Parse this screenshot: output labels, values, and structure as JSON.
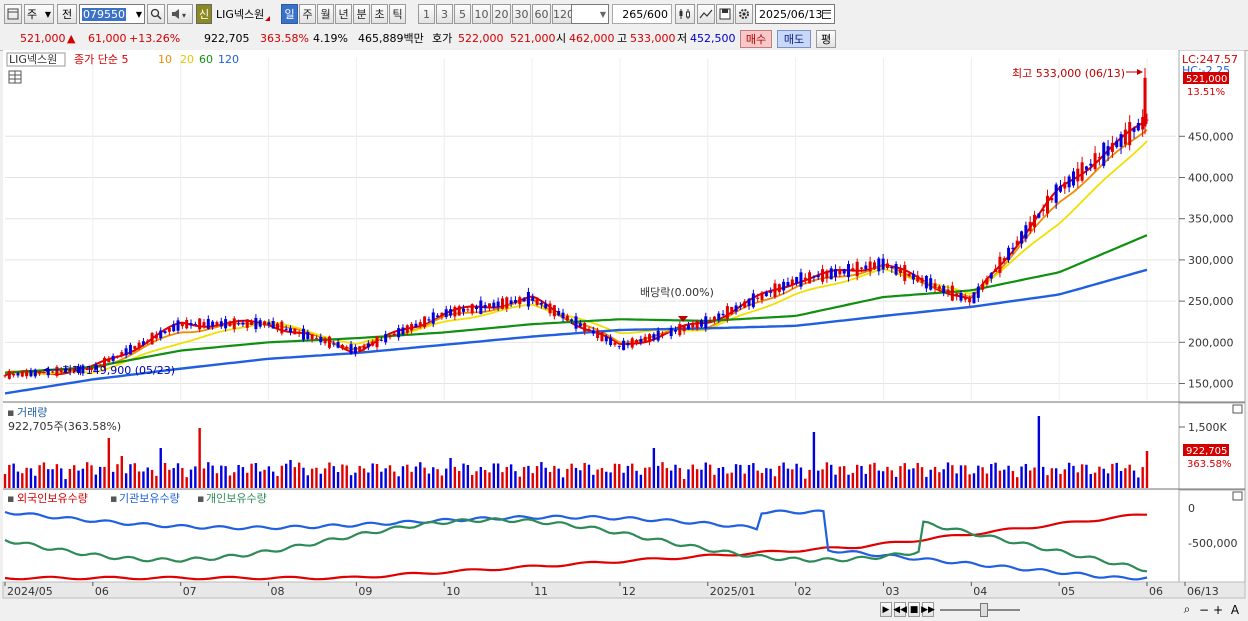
{
  "toolbar": {
    "mode_label": "주",
    "prev_label": "전",
    "code_value": "079550",
    "market_badge": "신",
    "stock_name": "LIG넥스원",
    "period_tabs": [
      "일",
      "주",
      "월",
      "년",
      "분",
      "초",
      "틱"
    ],
    "active_period": "일",
    "interval_tabs": [
      "1",
      "3",
      "5",
      "10",
      "20",
      "30",
      "60",
      "120"
    ],
    "count_value": "265",
    "count_total": "/600",
    "date_value": "2025/06/13"
  },
  "quote": {
    "price": "521,000",
    "arrow": "▲",
    "change": "61,000",
    "change_pct": "+13.26%",
    "volume": "922,705",
    "volume_ratio": "363.58%",
    "turnover_rate": "4.19%",
    "trade_value": "465,889백만",
    "bid_label": "호가",
    "ask_price": "522,000",
    "bid_price": "521,000",
    "open_label": "시",
    "open": "462,000",
    "high_label": "고",
    "high": "533,000",
    "low_label": "저",
    "low": "452,500",
    "buy_label": "매수",
    "sell_label": "매도",
    "eval_label": "평"
  },
  "price_panel": {
    "name_label": "LIG넥스원",
    "ma_title": "종가 단순 5",
    "ma_periods": [
      "10",
      "20",
      "60",
      "120"
    ],
    "lc_label": "LC:247.57",
    "hc_label": "HC:-2.25",
    "high_annotation": "최고 533,000 (06/13)",
    "low_annotation": "최저 149,900 (05/23)",
    "dividend_annotation": "배당락(0.00%)",
    "current_price_box": "521,000",
    "current_pct": "13.51%",
    "y_ticks": [
      "450,000",
      "400,000",
      "350,000",
      "300,000",
      "250,000",
      "200,000",
      "150,000"
    ]
  },
  "volume_panel": {
    "title": "거래량",
    "info": "922,705주(363.58%)",
    "y_tick": "1,500K",
    "current_box": "922,705",
    "current_pct": "363.58%"
  },
  "holding_panel": {
    "series_labels": [
      "외국인보유수량",
      "기관보유수량",
      "개인보유수량"
    ],
    "y_ticks": [
      "0",
      "-500,000"
    ]
  },
  "x_axis": [
    "2024/05",
    "06",
    "07",
    "08",
    "09",
    "10",
    "11",
    "12",
    "2025/01",
    "02",
    "03",
    "04",
    "05",
    "06",
    "06/13"
  ],
  "colors": {
    "rise": "#e00000",
    "fall": "#0000e0",
    "ma5": "#e00000",
    "ma10": "#f08c00",
    "ma20": "#f0e000",
    "ma60": "#109010",
    "ma120": "#2060e0",
    "foreign": "#e00000",
    "institution": "#2060e0",
    "individual": "#2e8b57",
    "toolbar_active": "#3b72c8"
  },
  "chart_data": {
    "type": "line",
    "title": "",
    "x": [
      "2024/05",
      "06",
      "07",
      "08",
      "09",
      "10",
      "11",
      "12",
      "2025/01",
      "02",
      "03",
      "04",
      "05",
      "06"
    ],
    "series": [
      {
        "name": "5",
        "values": [
          160000,
          168000,
          222000,
          223000,
          190000,
          235000,
          253000,
          195000,
          225000,
          275000,
          295000,
          250000,
          385000,
          470000
        ]
      },
      {
        "name": "10",
        "values": [
          162000,
          166000,
          213000,
          225000,
          192000,
          230000,
          250000,
          200000,
          220000,
          268000,
          292000,
          252000,
          370000,
          460000
        ]
      },
      {
        "name": "20",
        "values": [
          163000,
          163000,
          200000,
          226000,
          197000,
          224000,
          246000,
          212000,
          216000,
          258000,
          288000,
          258000,
          345000,
          445000
        ]
      },
      {
        "name": "60",
        "values": [
          163000,
          170000,
          190000,
          200000,
          205000,
          212000,
          222000,
          228000,
          226000,
          232000,
          255000,
          263000,
          285000,
          330000
        ]
      },
      {
        "name": "120",
        "values": [
          138000,
          155000,
          168000,
          180000,
          187000,
          197000,
          207000,
          215000,
          217000,
          220000,
          232000,
          243000,
          258000,
          288000
        ]
      }
    ],
    "ylim": [
      130000,
      545000
    ],
    "high": {
      "value": 533000,
      "date": "06/13"
    },
    "low": {
      "value": 149900,
      "date": "05/23"
    }
  }
}
